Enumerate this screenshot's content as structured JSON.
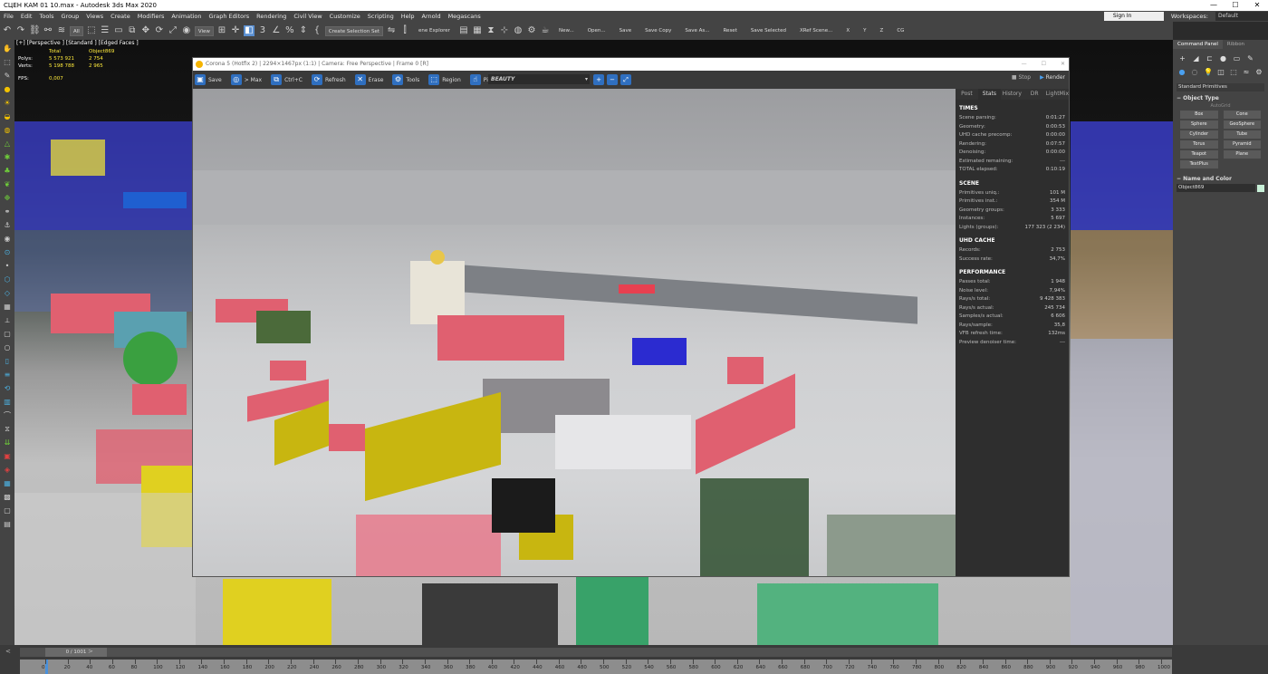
{
  "window": {
    "title": "СЦЕН КАМ 01 10.max - Autodesk 3ds Max 2020",
    "controls": [
      "—",
      "☐",
      "✕"
    ]
  },
  "menu": [
    "File",
    "Edit",
    "Tools",
    "Group",
    "Views",
    "Create",
    "Modifiers",
    "Animation",
    "Graph Editors",
    "Rendering",
    "Civil View",
    "Customize",
    "Scripting",
    "Help",
    "Arnold",
    "Megascans"
  ],
  "account": {
    "signin": "Sign In",
    "workspaces_label": "Workspaces:",
    "workspace": "Default"
  },
  "toolbar": {
    "filter": "All",
    "view": "View",
    "selection_set": "Create Selection Set",
    "scene_explorer": "ene Explorer",
    "scripts": [
      "New...",
      "Open...",
      "Save",
      "Save Copy",
      "Save As...",
      "Reset",
      "Save Selected",
      "XRef Scene...",
      "X",
      "Y",
      "Z",
      "CG"
    ]
  },
  "viewport": {
    "label": "[+] [Perspective ] [Standard ] [Edged Faces ]",
    "stats": {
      "header": [
        "",
        "Total",
        "Object869"
      ],
      "polys": [
        "Polys:",
        "5 573 921",
        "2 754"
      ],
      "verts": [
        "Verts:",
        "5 198 788",
        "2 965"
      ],
      "fps": [
        "FPS:",
        "0,007"
      ]
    }
  },
  "vfb": {
    "title": "Corona 5 (Hotfix 2) | 2294×1467px (1:1) | Camera: Free Perspective | Frame 0 [R]",
    "tools": [
      "Save",
      "> Max",
      "Ctrl+C",
      "Refresh",
      "Erase",
      "Tools",
      "Region",
      "Pick"
    ],
    "render_element": "BEAUTY",
    "stop": "Stop",
    "render": "Render",
    "tabs": [
      "Post",
      "Stats",
      "History",
      "DR",
      "LightMix"
    ],
    "active_tab": "Stats",
    "sections": [
      {
        "title": "TIMES",
        "rows": [
          [
            "Scene parsing:",
            "0:01:27"
          ],
          [
            "Geometry:",
            "0:00:53"
          ],
          [
            "UHD cache precomp:",
            "0:00:00"
          ],
          [
            "Rendering:",
            "0:07:57"
          ],
          [
            "Denoising:",
            "0:00:00"
          ],
          [
            "Estimated remaining:",
            "---"
          ],
          [
            "TOTAL elapsed:",
            "0:10:19"
          ]
        ]
      },
      {
        "title": "SCENE",
        "rows": [
          [
            "Primitives uniq.:",
            "101 M"
          ],
          [
            "Primitives inst.:",
            "354 M"
          ],
          [
            "Geometry groups:",
            "3 333"
          ],
          [
            "Instances:",
            "5 697"
          ],
          [
            "Lights (groups):",
            "177 323 (2 234)"
          ]
        ]
      },
      {
        "title": "UHD CACHE",
        "rows": [
          [
            "Records:",
            "2 753"
          ],
          [
            "Success rate:",
            "34,7%"
          ]
        ]
      },
      {
        "title": "PERFORMANCE",
        "rows": [
          [
            "Passes total:",
            "1 948"
          ],
          [
            "Noise level:",
            "7,94%"
          ],
          [
            "Rays/s total:",
            "9 428 383"
          ],
          [
            "Rays/s actual:",
            "245 734"
          ],
          [
            "Samples/s actual:",
            "6 606"
          ],
          [
            "Rays/sample:",
            "35,8"
          ],
          [
            "VFB refresh time:",
            "132ms"
          ],
          [
            "Preview denoiser time:",
            "---"
          ]
        ]
      }
    ]
  },
  "command_panel": {
    "tabs": [
      "Command Panel",
      "Ribbon"
    ],
    "category": "Standard Primitives",
    "object_type_title": "Object Type",
    "autogrid": "AutoGrid",
    "buttons": [
      "Box",
      "Cone",
      "Sphere",
      "GeoSphere",
      "Cylinder",
      "Tube",
      "Torus",
      "Pyramid",
      "Teapot",
      "Plane",
      "TextPlus"
    ],
    "name_color_title": "Name and Color",
    "object_name": "Object869"
  },
  "timeline": {
    "frame": "0 / 1001",
    "ticks": [
      "0",
      "20",
      "40",
      "60",
      "80",
      "100",
      "120",
      "140",
      "160",
      "180",
      "200",
      "220",
      "240",
      "260",
      "280",
      "300",
      "320",
      "340",
      "360",
      "380",
      "400",
      "420",
      "440",
      "460",
      "480",
      "500",
      "520",
      "540",
      "560",
      "580",
      "600",
      "620",
      "640",
      "660",
      "680",
      "700",
      "720",
      "740",
      "760",
      "780",
      "800",
      "820",
      "840",
      "860",
      "880",
      "900",
      "920",
      "940",
      "960",
      "980",
      "1000"
    ]
  }
}
